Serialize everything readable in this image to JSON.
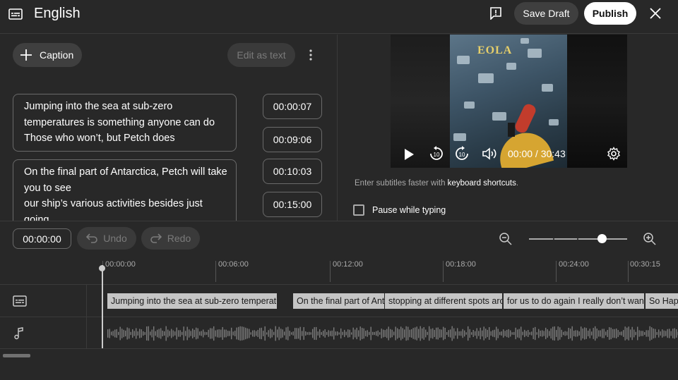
{
  "header": {
    "title": "English",
    "save_draft": "Save Draft",
    "publish": "Publish"
  },
  "editor": {
    "caption_button": "Caption",
    "edit_as_text": "Edit as text",
    "captions": [
      {
        "lines": [
          "Jumping into the sea at sub-zero",
          "temperatures is something anyone can do",
          "Those who won’t, but Petch does"
        ]
      },
      {
        "lines": [
          "On the final part of Antarctica, Petch will take",
          "you to see",
          "our ship’s various activities besides just",
          "going"
        ]
      }
    ],
    "timestamps": [
      "00:00:07",
      "00:09:06",
      "00:10:03",
      "00:15:00"
    ]
  },
  "video": {
    "logo_text": "EOLA",
    "time_display": "00:00 / 30:43",
    "hint_prefix": "Enter subtitles faster with ",
    "hint_link": "keyboard shortcuts",
    "hint_suffix": ".",
    "pause_label": "Pause while typing"
  },
  "timeline": {
    "current_time": "00:00:00",
    "undo": "Undo",
    "redo": "Redo",
    "zoom_level": 0.7,
    "ruler": [
      "00:00:00",
      "00:06:00",
      "00:12:00",
      "00:18:00",
      "00:24:00",
      "00:30:15"
    ],
    "segments": [
      "Jumping into the sea at sub-zero temperatures is something anyone can do",
      "On the final part of Antarctica",
      "stopping at different spots around the bay",
      "for us to do again I really don’t want to leave",
      "So Happy"
    ]
  },
  "colors": {
    "background": "#282828",
    "button": "#3f3f3f",
    "publish_bg": "#ffffff",
    "segment": "#c5c5c5"
  }
}
